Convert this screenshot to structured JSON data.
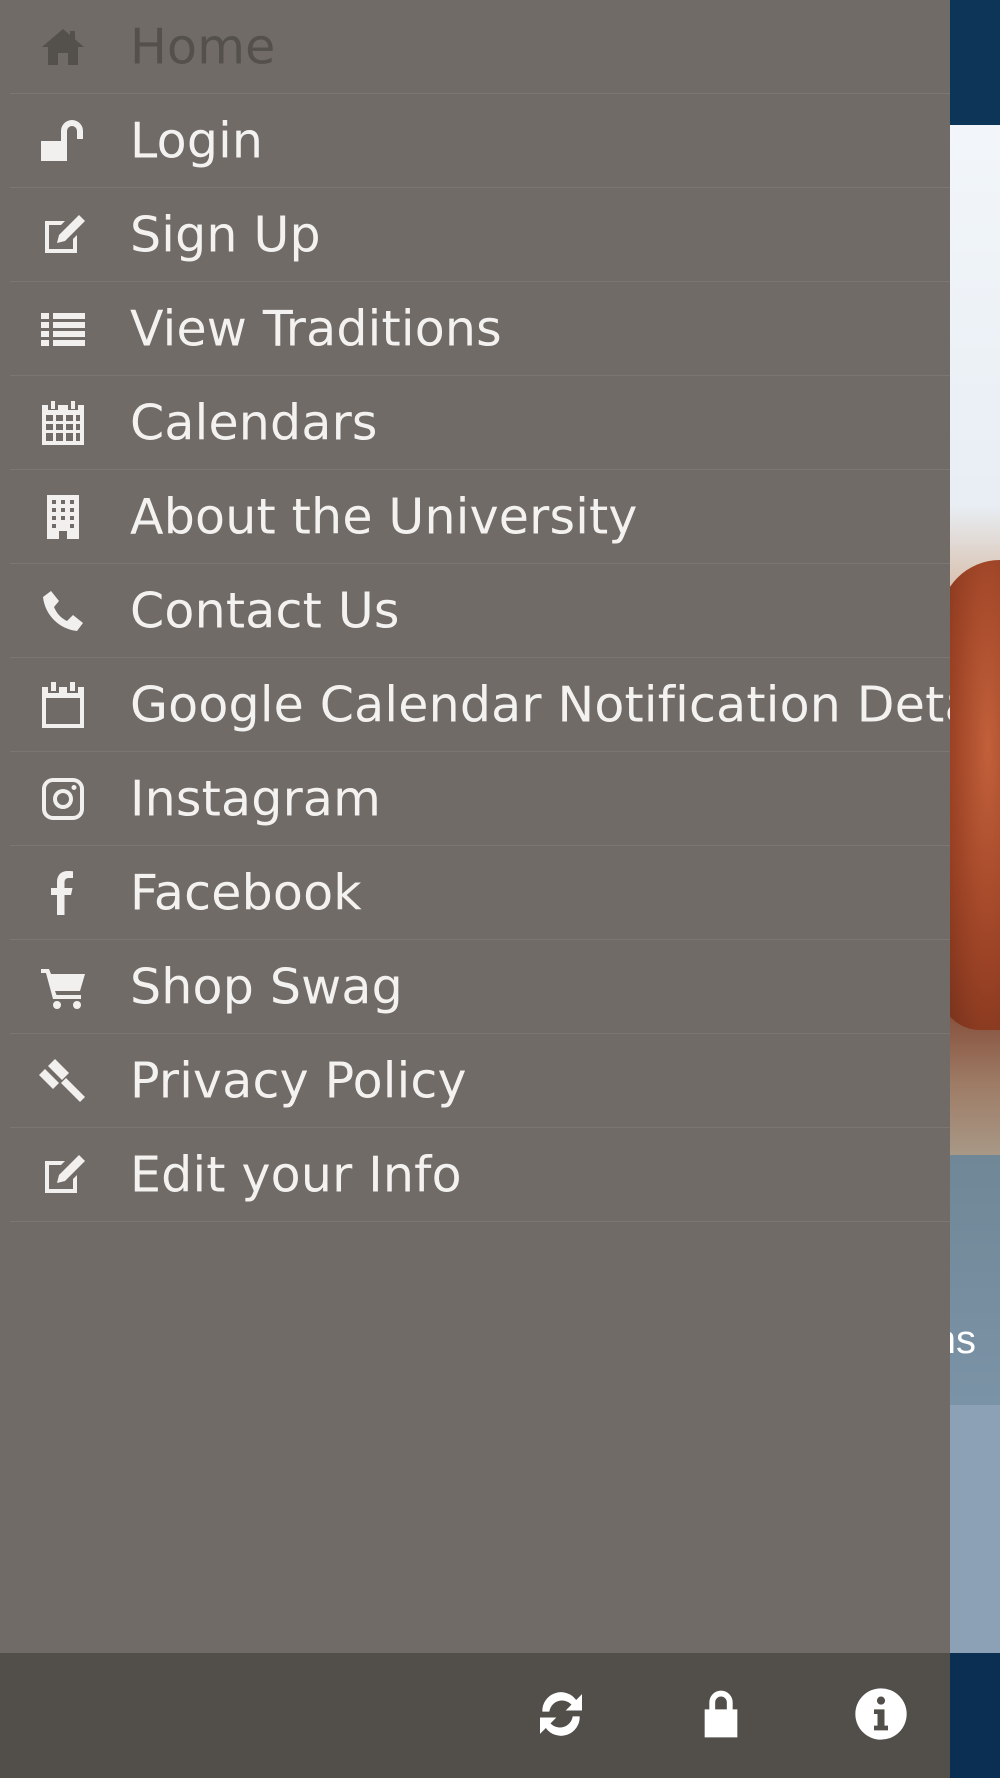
{
  "background": {
    "partial_text": "ns"
  },
  "menu": {
    "items": [
      {
        "label": "Home",
        "icon": "home-icon",
        "active": true
      },
      {
        "label": "Login",
        "icon": "unlock-icon"
      },
      {
        "label": "Sign Up",
        "icon": "edit-icon"
      },
      {
        "label": "View Traditions",
        "icon": "list-icon"
      },
      {
        "label": "Calendars",
        "icon": "calendar-grid-icon"
      },
      {
        "label": "About the University",
        "icon": "building-icon"
      },
      {
        "label": "Contact Us",
        "icon": "phone-icon"
      },
      {
        "label": "Google Calendar Notification Detail",
        "icon": "calendar-icon"
      },
      {
        "label": "Instagram",
        "icon": "instagram-icon"
      },
      {
        "label": "Facebook",
        "icon": "facebook-icon"
      },
      {
        "label": "Shop Swag",
        "icon": "cart-icon"
      },
      {
        "label": "Privacy Policy",
        "icon": "gavel-icon"
      },
      {
        "label": "Edit your Info",
        "icon": "edit-icon"
      }
    ]
  },
  "toolbar": {
    "buttons": [
      {
        "name": "refresh-button",
        "icon": "refresh-icon"
      },
      {
        "name": "lock-button",
        "icon": "lock-icon"
      },
      {
        "name": "info-button",
        "icon": "info-icon"
      }
    ]
  },
  "colors": {
    "menu_bg": "#706b66",
    "toolbar_bg": "#524f4b",
    "header_bg": "#0d3558",
    "active_text": "#54504c",
    "text": "#f4f2f0"
  }
}
